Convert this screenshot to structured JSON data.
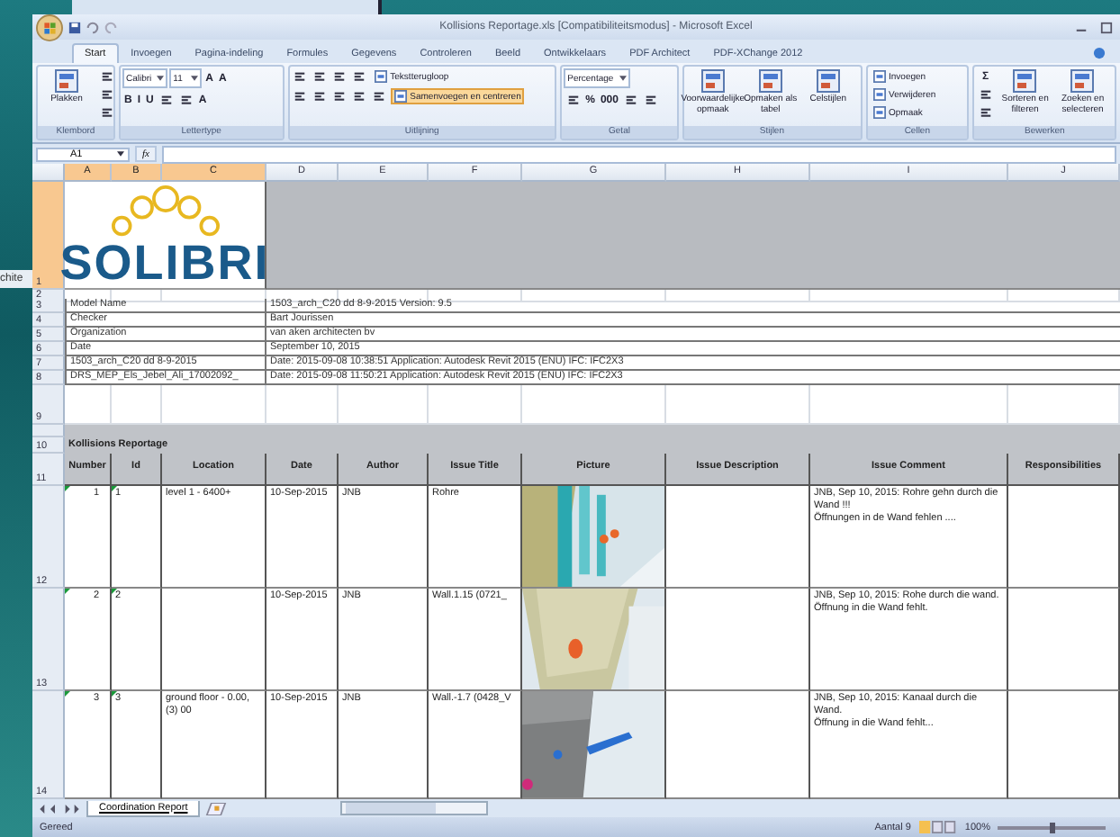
{
  "desktop": {
    "background_text": "chite"
  },
  "window": {
    "title": "Kollisions Reportage.xls [Compatibiliteitsmodus] - Microsoft Excel"
  },
  "ribbon": {
    "tabs": [
      {
        "label": "Start",
        "selected": true
      },
      {
        "label": "Invoegen",
        "selected": false
      },
      {
        "label": "Pagina-indeling",
        "selected": false
      },
      {
        "label": "Formules",
        "selected": false
      },
      {
        "label": "Gegevens",
        "selected": false
      },
      {
        "label": "Controleren",
        "selected": false
      },
      {
        "label": "Beeld",
        "selected": false
      },
      {
        "label": "Ontwikkelaars",
        "selected": false
      },
      {
        "label": "PDF Architect",
        "selected": false
      },
      {
        "label": "PDF-XChange 2012",
        "selected": false
      }
    ],
    "groups": [
      {
        "label": "Klembord",
        "kind": "clipboard",
        "control_groups": [
          [
            {
              "kind": "big",
              "label": "Plakken"
            }
          ],
          [
            {
              "kind": "tool"
            },
            {
              "kind": "tool"
            },
            {
              "kind": "tool"
            }
          ]
        ]
      },
      {
        "label": "Lettertype",
        "kind": "font",
        "control_groups": [
          [
            {
              "kind": "field",
              "value": "Calibri"
            },
            {
              "kind": "field",
              "value": "11"
            },
            {
              "kind": "glyph",
              "label": "A"
            },
            {
              "kind": "glyph",
              "label": "A"
            }
          ],
          [
            {
              "kind": "glyph",
              "label": "B"
            },
            {
              "kind": "glyph",
              "label": "I"
            },
            {
              "kind": "glyph",
              "label": "U"
            },
            {
              "kind": "tool"
            },
            {
              "kind": "tool"
            },
            {
              "kind": "glyph",
              "label": "A"
            }
          ]
        ]
      },
      {
        "label": "Uitlijning",
        "kind": "alignment",
        "control_groups": [
          [
            {
              "kind": "tool"
            },
            {
              "kind": "tool"
            },
            {
              "kind": "tool"
            },
            {
              "kind": "tool"
            },
            {
              "kind": "small",
              "label": "Tekstterugloop",
              "highlighted": false
            }
          ],
          [
            {
              "kind": "tool"
            },
            {
              "kind": "tool"
            },
            {
              "kind": "tool"
            },
            {
              "kind": "tool"
            },
            {
              "kind": "tool"
            },
            {
              "kind": "small",
              "label": "Samenvoegen en centreren",
              "highlighted": true
            }
          ]
        ]
      },
      {
        "label": "Getal",
        "kind": "number",
        "control_groups": [
          [
            {
              "kind": "field",
              "value": "Percentage"
            }
          ],
          [
            {
              "kind": "tool"
            },
            {
              "kind": "glyph",
              "label": "%"
            },
            {
              "kind": "glyph",
              "label": "000"
            },
            {
              "kind": "tool"
            },
            {
              "kind": "tool"
            }
          ]
        ]
      },
      {
        "label": "Stijlen",
        "kind": "styles",
        "control_groups": [
          [
            {
              "kind": "big",
              "label": "Voorwaardelijke opmaak"
            }
          ],
          [
            {
              "kind": "big",
              "label": "Opmaken als tabel"
            }
          ],
          [
            {
              "kind": "big",
              "label": "Celstijlen"
            }
          ]
        ]
      },
      {
        "label": "Cellen",
        "kind": "cells",
        "control_groups": [
          [
            {
              "kind": "small",
              "label": "Invoegen",
              "highlighted": false
            },
            {
              "kind": "small",
              "label": "Verwijderen",
              "highlighted": false
            },
            {
              "kind": "small",
              "label": "Opmaak",
              "highlighted": false
            }
          ]
        ]
      },
      {
        "label": "Bewerken",
        "kind": "editing",
        "control_groups": [
          [
            {
              "kind": "glyph",
              "label": "Σ"
            },
            {
              "kind": "tool"
            },
            {
              "kind": "tool"
            }
          ],
          [
            {
              "kind": "big",
              "label": "Sorteren en filteren"
            }
          ],
          [
            {
              "kind": "big",
              "label": "Zoeken en selecteren"
            }
          ]
        ]
      }
    ]
  },
  "formula_bar": {
    "name_box": "A1",
    "function_label": "fx"
  },
  "sheet": {
    "columns": [
      {
        "label": "A",
        "selected": true
      },
      {
        "label": "B",
        "selected": true
      },
      {
        "label": "C",
        "selected": true
      },
      {
        "label": "D",
        "selected": false
      },
      {
        "label": "E",
        "selected": false
      },
      {
        "label": "F",
        "selected": false
      },
      {
        "label": "G",
        "selected": false
      },
      {
        "label": "H",
        "selected": false
      },
      {
        "label": "I",
        "selected": false
      },
      {
        "label": "J",
        "selected": false
      }
    ],
    "row_headers": [
      {
        "label": "1",
        "selected": true
      },
      {
        "label": "2",
        "selected": false
      },
      {
        "label": "3",
        "selected": false
      },
      {
        "label": "4",
        "selected": false
      },
      {
        "label": "5",
        "selected": false
      },
      {
        "label": "6",
        "selected": false
      },
      {
        "label": "7",
        "selected": false
      },
      {
        "label": "8",
        "selected": false
      },
      {
        "label": "9",
        "selected": false
      },
      {
        "label": "10",
        "selected": false
      },
      {
        "label": "11",
        "selected": false
      },
      {
        "label": "12",
        "selected": false
      },
      {
        "label": "13",
        "selected": false
      },
      {
        "label": "14",
        "selected": false
      }
    ],
    "logo": {
      "text": "SOLIBRI"
    },
    "info_rows": [
      {
        "label": "Model Name",
        "value": "1503_arch_C20 dd 8-9-2015 Version: 9.5"
      },
      {
        "label": "Checker",
        "value": "Bart Jourissen"
      },
      {
        "label": "Organization",
        "value": "van aken architecten bv"
      },
      {
        "label": "Date",
        "value": "September 10, 2015"
      },
      {
        "label": "1503_arch_C20 dd 8-9-2015",
        "value": "Date: 2015-09-08 10:38:51 Application: Autodesk Revit 2015 (ENU) IFC: IFC2X3"
      },
      {
        "label": "DRS_MEP_Els_Jebel_Ali_17002092_",
        "value": "Date: 2015-09-08 11:50:21 Application: Autodesk Revit 2015 (ENU) IFC: IFC2X3"
      }
    ],
    "report_title": "Kollisions Reportage",
    "table": {
      "columns": [
        "Number",
        "Id",
        "Location",
        "Date",
        "Author",
        "Issue Title",
        "Picture",
        "Issue Description",
        "Issue Comment",
        "Responsibilities"
      ],
      "rows": [
        {
          "number": "1",
          "id": "1",
          "location": "level 1 - 6400+",
          "date": "10-Sep-2015",
          "author": "JNB",
          "issue_title": "Rohre",
          "comment": [
            "JNB, Sep 10, 2015: Rohre gehn durch die Wand !!!",
            "Öffnungen in de Wand fehlen ...."
          ]
        },
        {
          "number": "2",
          "id": "2",
          "date": "10-Sep-2015",
          "author": "JNB",
          "issue_title": "Wall.1.15 (0721_",
          "comment": [
            "JNB, Sep 10, 2015: Rohe durch die wand.",
            "Öffnung in die Wand fehlt."
          ]
        },
        {
          "number": "3",
          "id": "3",
          "location": "ground floor - 0.00, (3) 00",
          "date": "10-Sep-2015",
          "author": "JNB",
          "issue_title": "Wall.-1.7 (0428_V",
          "comment": [
            "JNB, Sep 10, 2015: Kanaal durch die Wand.",
            "Öffnung in die Wand fehlt..."
          ]
        }
      ]
    }
  },
  "sheet_tabs": [
    {
      "label": "Coordination Report",
      "selected": true
    }
  ],
  "status_bar": {
    "left": "Gereed",
    "count": "Aantal 9",
    "zoom": "100%",
    "zoom_slider": {
      "level": 0.5
    }
  }
}
